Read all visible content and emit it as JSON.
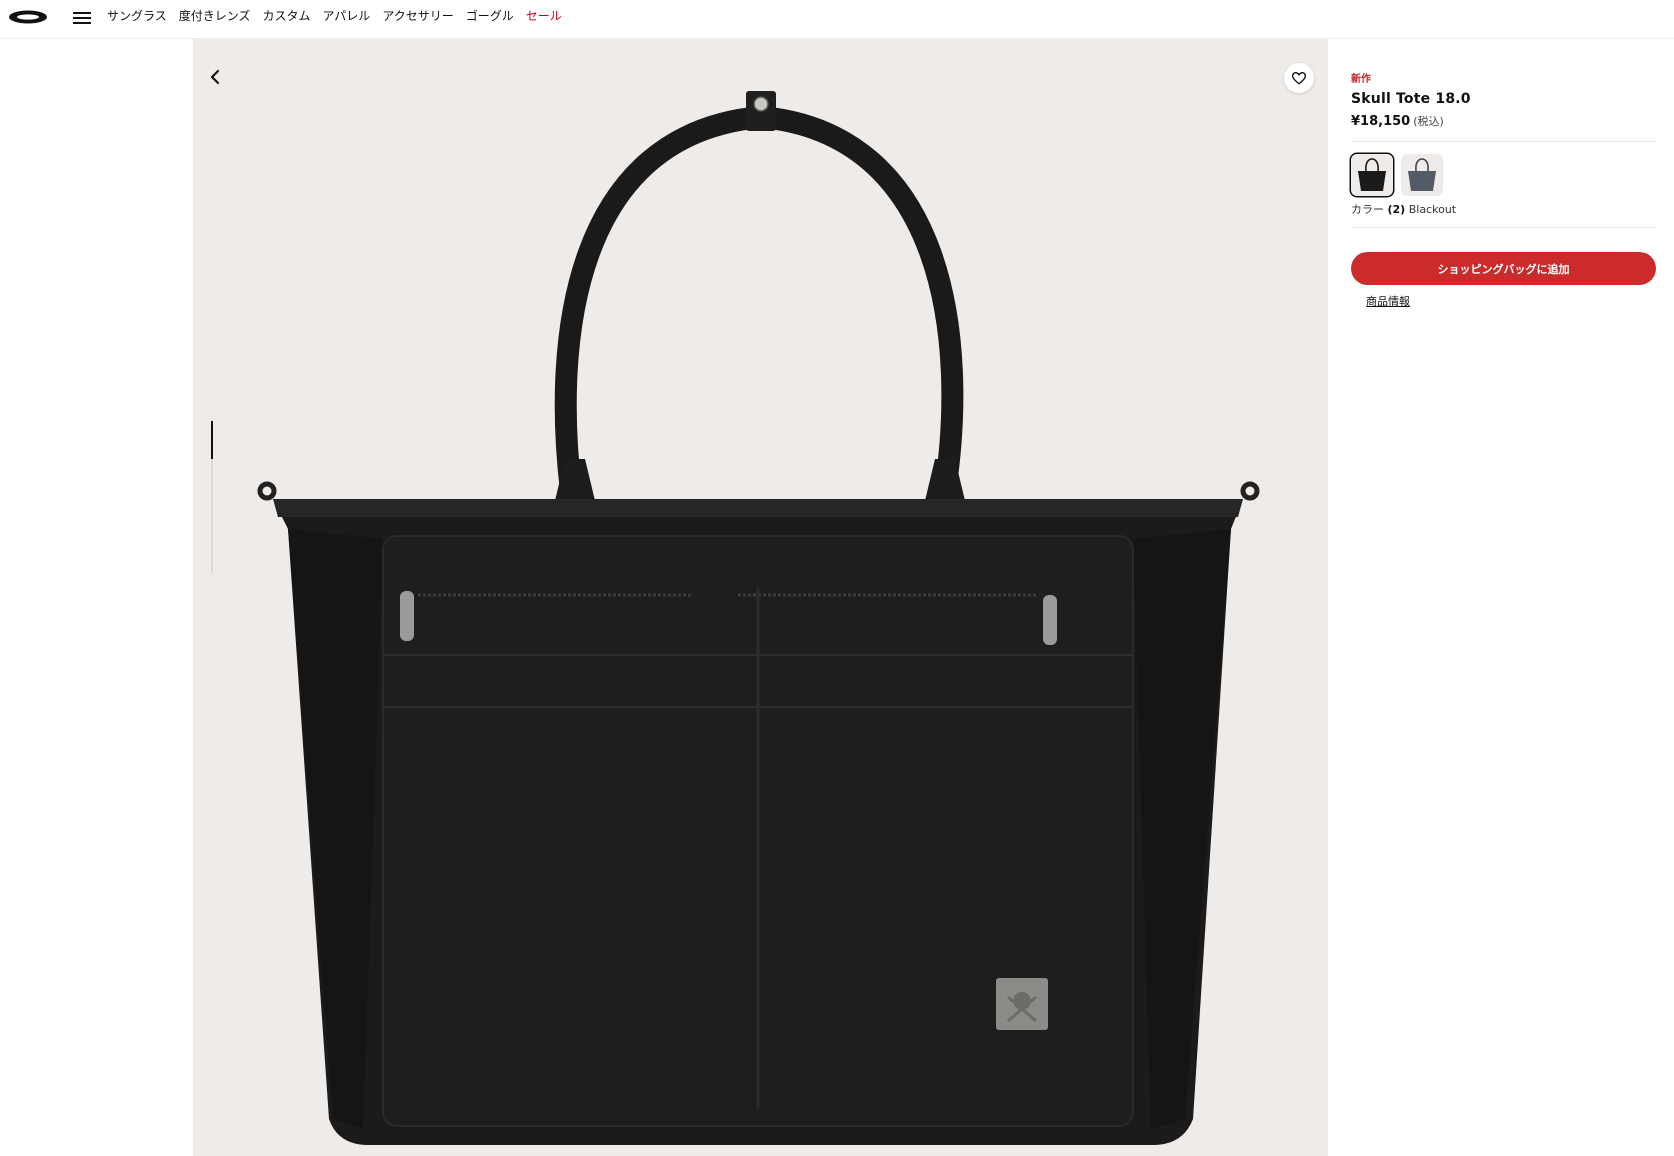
{
  "nav": {
    "items": [
      "サングラス",
      "度付きレンズ",
      "カスタム",
      "アパレル",
      "アクセサリー",
      "ゴーグル"
    ],
    "sale_label": "セール"
  },
  "icons": {
    "logo": "oakley-ellipse-logo",
    "menu": "hamburger-icon",
    "back": "chevron-left-icon",
    "favorite": "heart-icon"
  },
  "gallery": {
    "image_count": 4,
    "active_index": 0
  },
  "product": {
    "badge": "新作",
    "name": "Skull Tote 18.0",
    "price": "¥18,150",
    "tax_note": "(税込)",
    "color_label": "カラー",
    "color_count": "(2)",
    "color_name": "Blackout",
    "swatches": [
      "Blackout",
      "Gray"
    ],
    "add_to_bag": "ショッピングバッグに追加",
    "info_link": "商品情報"
  },
  "colors": {
    "accent_red": "#cc2b2b",
    "sale_red": "#d0021b",
    "gallery_bg": "#efebe8"
  }
}
